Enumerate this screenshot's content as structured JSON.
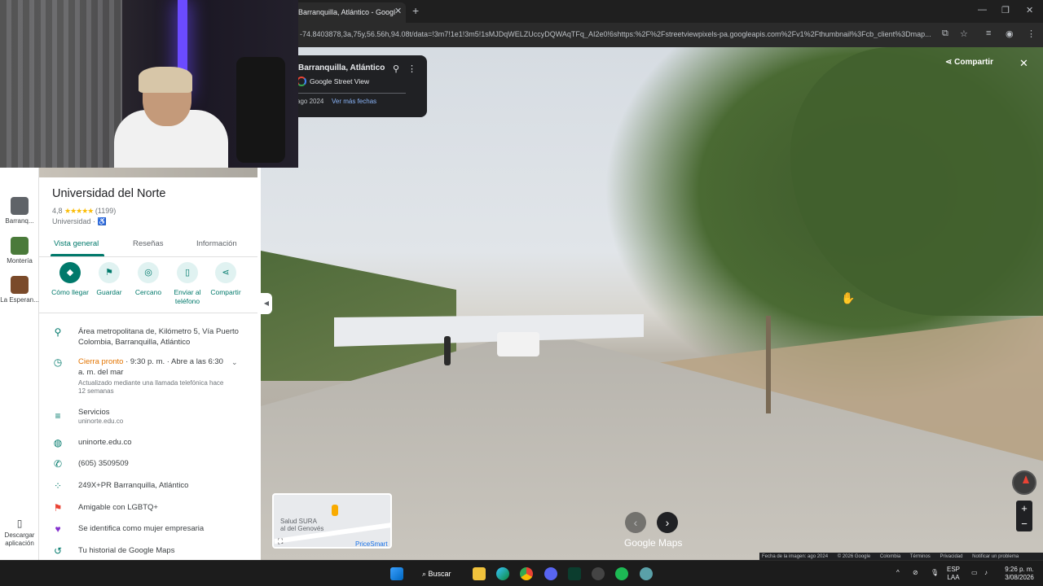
{
  "browser": {
    "tab_title": "Barranquilla, Atlántico - Googl",
    "url": "-74.8403878,3a,75y,56.56h,94.08t/data=!3m7!1e1!3m5!1sMJDqWELZUccyDQWAqTFq_AI2e0!6shttps:%2F%2Fstreetviewpixels-pa.googleapis.com%2Fv1%2Fthumbnail%3Fcb_client%3Dmap..."
  },
  "street_view": {
    "location_title": "Barranquilla, Atlántico",
    "source": "Google Street View",
    "date": "ago 2024",
    "more_dates_link": "Ver más fechas",
    "share_label": "Compartir",
    "logo_text": "Google Maps",
    "footer": [
      "Fecha de la imagen: ago 2024",
      "© 2026 Google",
      "Colombia",
      "Términos",
      "Privacidad",
      "Notificar un problema"
    ],
    "minimap": {
      "label1": "Salud SURA",
      "label2": "al del Genovés",
      "label3": "PriceSmart"
    }
  },
  "rail": {
    "items": [
      {
        "label": "Barranq...",
        "color": "#5f6368"
      },
      {
        "label": "Montería",
        "color": "#4a7a3a"
      },
      {
        "label": "La Esperan...",
        "color": "#7a4a2a"
      }
    ],
    "download_label": "Descargar aplicación"
  },
  "place": {
    "name": "Universidad del Norte",
    "rating": "4,8",
    "stars": "★★★★★",
    "reviews": "(1199)",
    "category": "Universidad ·",
    "tabs": [
      "Vista general",
      "Reseñas",
      "Información"
    ],
    "actions": [
      "Cómo llegar",
      "Guardar",
      "Cercano",
      "Enviar al teléfono",
      "Compartir"
    ],
    "address": "Área metropolitana de, Kilómetro 5, Vía Puerto Colombia, Barranquilla, Atlántico",
    "hours_status": "Cierra pronto",
    "hours_rest": "· 9:30 p. m. · Abre a las 6:30 a. m. del mar",
    "hours_note": "Actualizado mediante una llamada telefónica hace 12 semanas",
    "services_title": "Servicios",
    "services_sub": "uninorte.edu.co",
    "website": "uninorte.edu.co",
    "phone": "(605) 3509509",
    "plus_code": "249X+PR Barranquilla, Atlántico",
    "lgbtq": "Amigable con LGBTQ+",
    "women_owned": "Se identifica como mujer empresaria",
    "history": "Tu historial de Google Maps"
  },
  "taskbar": {
    "search_label": "Buscar",
    "lang": "ESP",
    "lang2": "LAA",
    "time": "9:26 p. m.",
    "date": "3/08/2026"
  }
}
